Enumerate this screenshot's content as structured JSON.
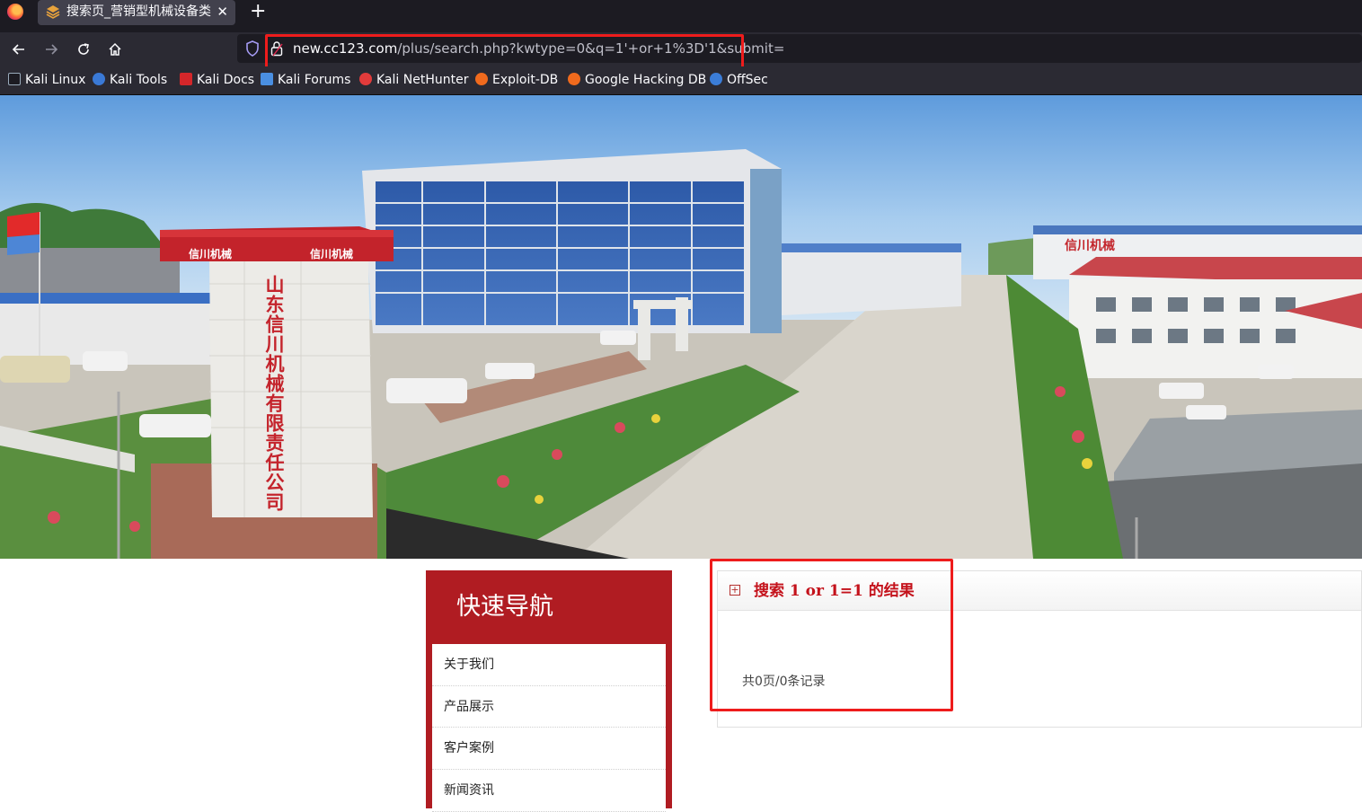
{
  "browser": {
    "tab_title": "搜索页_营销型机械设备类",
    "url_host": "new.cc123.com",
    "url_path": "/plus/search.php?kwtype=0&q=1'+or+1%3D'1&submit=",
    "bookmarks": [
      "Kali Linux",
      "Kali Tools",
      "Kali Docs",
      "Kali Forums",
      "Kali NetHunter",
      "Exploit-DB",
      "Google Hacking DB",
      "OffSec"
    ]
  },
  "banner": {
    "gate_text": "山东信川机械有限责任公司",
    "sign_left": "信川机械",
    "sign_right": "信川机械",
    "building_sign": "信川机械"
  },
  "sidebar": {
    "title": "快速导航",
    "items": [
      "关于我们",
      "产品展示",
      "客户案例",
      "新闻资讯"
    ]
  },
  "results": {
    "title": "搜索 1 or 1=1 的结果",
    "count_text": "共0页/0条记录"
  },
  "colors": {
    "accent_red": "#b01c22",
    "highlight_red": "#ee1c1c"
  }
}
